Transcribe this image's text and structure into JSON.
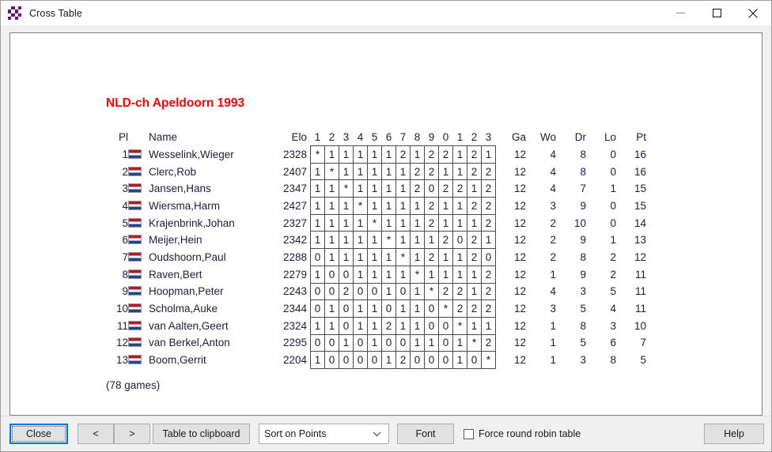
{
  "window": {
    "title": "Cross Table",
    "icon": "chessboard-icon",
    "controls": {
      "minimize": "minimize-icon",
      "maximize": "maximize-icon",
      "close": "close-icon"
    }
  },
  "table": {
    "title": "NLD-ch Apeldoorn 1993",
    "games_note": "(78 games)",
    "headers": {
      "pl": "Pl",
      "name": "Name",
      "elo": "Elo",
      "opponents": [
        "1",
        "2",
        "3",
        "4",
        "5",
        "6",
        "7",
        "8",
        "9",
        "0",
        "1",
        "2",
        "3"
      ],
      "ga": "Ga",
      "wo": "Wo",
      "dr": "Dr",
      "lo": "Lo",
      "pt": "Pt"
    },
    "rows": [
      {
        "pl": "1",
        "flag": "netherlands-flag",
        "name": "Wesselink,Wieger",
        "elo": "2328",
        "results": [
          "*",
          "1",
          "1",
          "1",
          "1",
          "1",
          "2",
          "1",
          "2",
          "2",
          "1",
          "2",
          "1"
        ],
        "ga": "12",
        "wo": "4",
        "dr": "8",
        "lo": "0",
        "pt": "16"
      },
      {
        "pl": "2",
        "flag": "netherlands-flag",
        "name": "Clerc,Rob",
        "elo": "2407",
        "results": [
          "1",
          "*",
          "1",
          "1",
          "1",
          "1",
          "1",
          "2",
          "2",
          "1",
          "1",
          "2",
          "2"
        ],
        "ga": "12",
        "wo": "4",
        "dr": "8",
        "lo": "0",
        "pt": "16"
      },
      {
        "pl": "3",
        "flag": "netherlands-flag",
        "name": "Jansen,Hans",
        "elo": "2347",
        "results": [
          "1",
          "1",
          "*",
          "1",
          "1",
          "1",
          "1",
          "2",
          "0",
          "2",
          "2",
          "1",
          "2"
        ],
        "ga": "12",
        "wo": "4",
        "dr": "7",
        "lo": "1",
        "pt": "15"
      },
      {
        "pl": "4",
        "flag": "netherlands-flag",
        "name": "Wiersma,Harm",
        "elo": "2427",
        "results": [
          "1",
          "1",
          "1",
          "*",
          "1",
          "1",
          "1",
          "1",
          "2",
          "1",
          "1",
          "2",
          "2"
        ],
        "ga": "12",
        "wo": "3",
        "dr": "9",
        "lo": "0",
        "pt": "15"
      },
      {
        "pl": "5",
        "flag": "netherlands-flag",
        "name": "Krajenbrink,Johan",
        "elo": "2327",
        "results": [
          "1",
          "1",
          "1",
          "1",
          "*",
          "1",
          "1",
          "1",
          "2",
          "1",
          "1",
          "1",
          "2"
        ],
        "ga": "12",
        "wo": "2",
        "dr": "10",
        "lo": "0",
        "pt": "14"
      },
      {
        "pl": "6",
        "flag": "netherlands-flag",
        "name": "Meijer,Hein",
        "elo": "2342",
        "results": [
          "1",
          "1",
          "1",
          "1",
          "1",
          "*",
          "1",
          "1",
          "1",
          "2",
          "0",
          "2",
          "1"
        ],
        "ga": "12",
        "wo": "2",
        "dr": "9",
        "lo": "1",
        "pt": "13"
      },
      {
        "pl": "7",
        "flag": "netherlands-flag",
        "name": "Oudshoorn,Paul",
        "elo": "2288",
        "results": [
          "0",
          "1",
          "1",
          "1",
          "1",
          "1",
          "*",
          "1",
          "2",
          "1",
          "1",
          "2",
          "0"
        ],
        "ga": "12",
        "wo": "2",
        "dr": "8",
        "lo": "2",
        "pt": "12"
      },
      {
        "pl": "8",
        "flag": "netherlands-flag",
        "name": "Raven,Bert",
        "elo": "2279",
        "results": [
          "1",
          "0",
          "0",
          "1",
          "1",
          "1",
          "1",
          "*",
          "1",
          "1",
          "1",
          "1",
          "2"
        ],
        "ga": "12",
        "wo": "1",
        "dr": "9",
        "lo": "2",
        "pt": "11"
      },
      {
        "pl": "9",
        "flag": "netherlands-flag",
        "name": "Hoopman,Peter",
        "elo": "2243",
        "results": [
          "0",
          "0",
          "2",
          "0",
          "0",
          "1",
          "0",
          "1",
          "*",
          "2",
          "2",
          "1",
          "2"
        ],
        "ga": "12",
        "wo": "4",
        "dr": "3",
        "lo": "5",
        "pt": "11"
      },
      {
        "pl": "10",
        "flag": "netherlands-flag",
        "name": "Scholma,Auke",
        "elo": "2344",
        "results": [
          "0",
          "1",
          "0",
          "1",
          "1",
          "0",
          "1",
          "1",
          "0",
          "*",
          "2",
          "2",
          "2"
        ],
        "ga": "12",
        "wo": "3",
        "dr": "5",
        "lo": "4",
        "pt": "11"
      },
      {
        "pl": "11",
        "flag": "netherlands-flag",
        "name": "van Aalten,Geert",
        "elo": "2324",
        "results": [
          "1",
          "1",
          "0",
          "1",
          "1",
          "2",
          "1",
          "1",
          "0",
          "0",
          "*",
          "1",
          "1"
        ],
        "ga": "12",
        "wo": "1",
        "dr": "8",
        "lo": "3",
        "pt": "10"
      },
      {
        "pl": "12",
        "flag": "netherlands-flag",
        "name": "van Berkel,Anton",
        "elo": "2295",
        "results": [
          "0",
          "0",
          "1",
          "0",
          "1",
          "0",
          "0",
          "1",
          "1",
          "0",
          "1",
          "*",
          "2"
        ],
        "ga": "12",
        "wo": "1",
        "dr": "5",
        "lo": "6",
        "pt": "7"
      },
      {
        "pl": "13",
        "flag": "netherlands-flag",
        "name": "Boom,Gerrit",
        "elo": "2204",
        "results": [
          "1",
          "0",
          "0",
          "0",
          "0",
          "1",
          "2",
          "0",
          "0",
          "0",
          "1",
          "0",
          "*"
        ],
        "ga": "12",
        "wo": "1",
        "dr": "3",
        "lo": "8",
        "pt": "5"
      }
    ]
  },
  "toolbar": {
    "close_label": "Close",
    "prev_label": "<",
    "next_label": ">",
    "clipboard_label": "Table to clipboard",
    "sort_value": "Sort on Points",
    "font_label": "Font",
    "checkbox_label": "Force round robin table",
    "checkbox_checked": false,
    "help_label": "Help"
  },
  "colors": {
    "title_red": "#ff0000",
    "focus_blue": "#0078d7",
    "icon_purple": "#7a0e7a",
    "text": "#1d1d3a"
  }
}
